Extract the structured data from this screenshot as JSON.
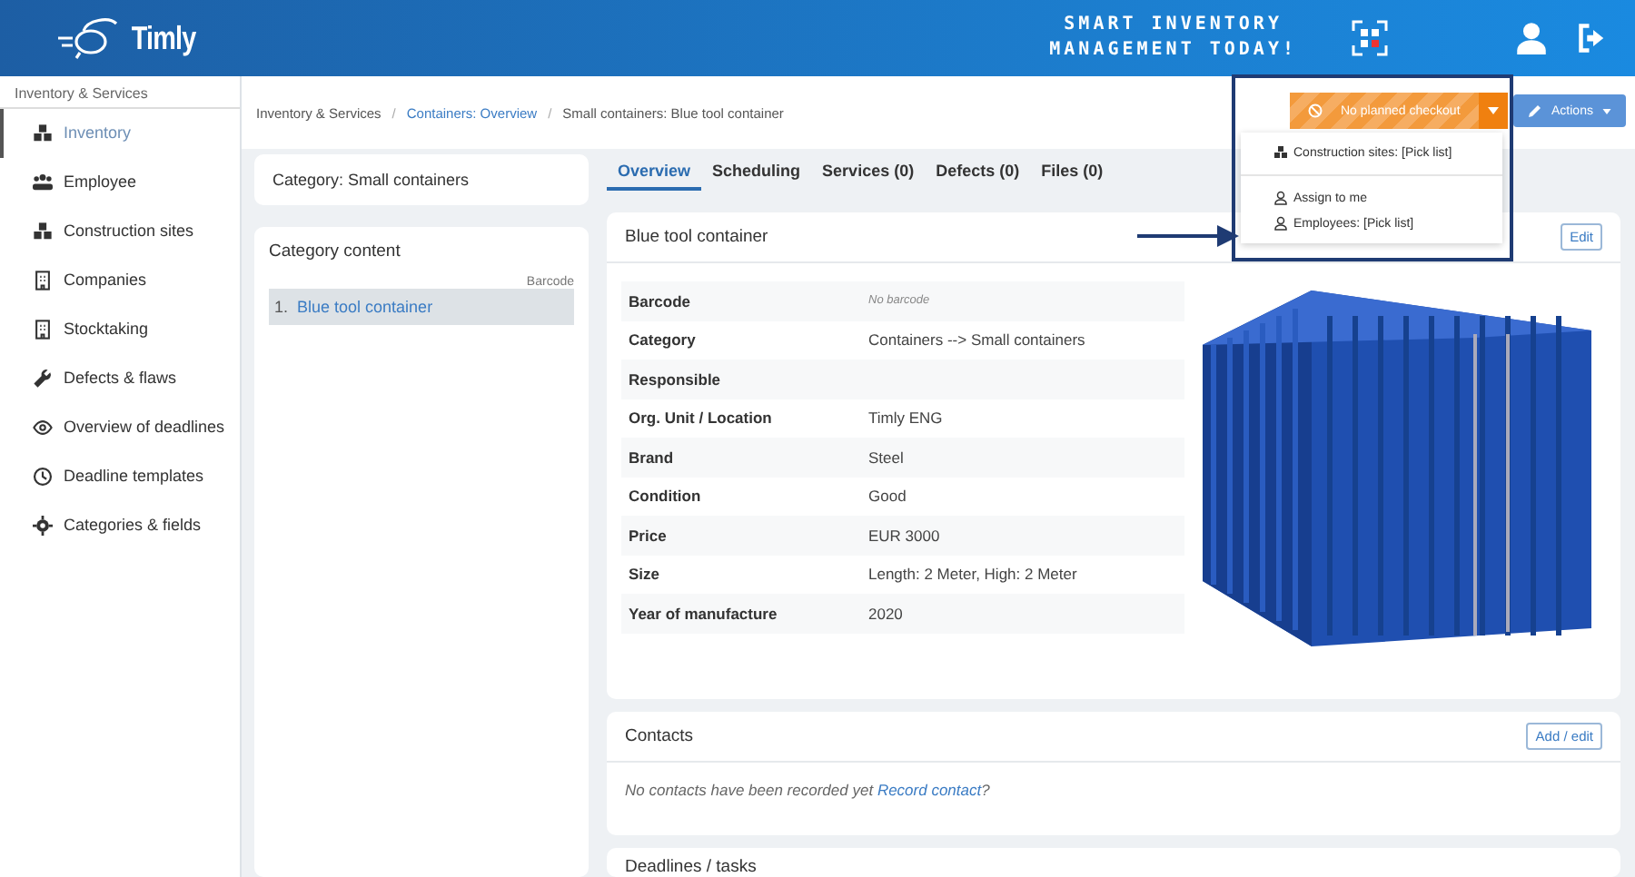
{
  "header": {
    "logo": "Timly",
    "slogan": [
      "SMART INVENTORY",
      "MANAGEMENT TODAY!"
    ]
  },
  "sidebar": {
    "section": "Inventory & Services",
    "items": [
      {
        "label": "Inventory",
        "selected": true
      },
      {
        "label": "Employee",
        "selected": false
      },
      {
        "label": "Construction sites",
        "selected": false
      },
      {
        "label": "Companies",
        "selected": false
      },
      {
        "label": "Stocktaking",
        "selected": false
      },
      {
        "label": "Defects & flaws",
        "selected": false
      },
      {
        "label": "Overview of deadlines",
        "selected": false
      },
      {
        "label": "Deadline templates",
        "selected": false
      },
      {
        "label": "Categories & fields",
        "selected": false
      }
    ]
  },
  "breadcrumb": [
    {
      "label": "Inventory & Services",
      "link": false
    },
    {
      "separator": "/",
      "label": "Containers: Overview",
      "link": true
    },
    {
      "separator": "/",
      "label": "Small containers: Blue tool container",
      "link": false
    }
  ],
  "checkout_button": "No planned checkout",
  "actions_button": "Actions",
  "checkout_menu": [
    {
      "label": "Construction sites: [Pick list]",
      "kind": "site"
    },
    {
      "label": "Assign to me",
      "kind": "person"
    },
    {
      "label": "Employees: [Pick list]",
      "kind": "person"
    }
  ],
  "category": "Category: Small containers",
  "category_content": {
    "title": "Category content",
    "column": "Barcode",
    "items": [
      {
        "number": "1.",
        "label": "Blue tool container",
        "selected": true
      }
    ]
  },
  "tabs": [
    {
      "label": "Overview",
      "selected": true
    },
    {
      "label": "Scheduling",
      "selected": false
    },
    {
      "label": "Services (0)",
      "selected": false
    },
    {
      "label": "Defects (0)",
      "selected": false
    },
    {
      "label": "Files (0)",
      "selected": false
    }
  ],
  "detail": {
    "title": "Blue tool container",
    "button": "Edit",
    "rows": [
      {
        "label": "Barcode",
        "note": "No barcode"
      },
      {
        "label": "Category",
        "value": "Containers --> Small containers"
      },
      {
        "label": "Responsible"
      },
      {
        "label": "Org. Unit / Location",
        "value": "Timly ENG"
      },
      {
        "label": "Brand",
        "value": "Steel"
      },
      {
        "label": "Condition",
        "value": "Good"
      },
      {
        "label": "Price",
        "value": "EUR 3000"
      },
      {
        "label": "Size",
        "value": "Length: 2 Meter, High: 2 Meter"
      },
      {
        "label": "Year of manufacture",
        "value": "2020"
      }
    ]
  },
  "contacts": {
    "title": "Contacts",
    "button": "Add / edit",
    "message": "No contacts have been recorded yet",
    "link": "Record contact",
    "suffix": "?"
  },
  "deadlines": {
    "title": "Deadlines / tasks"
  }
}
